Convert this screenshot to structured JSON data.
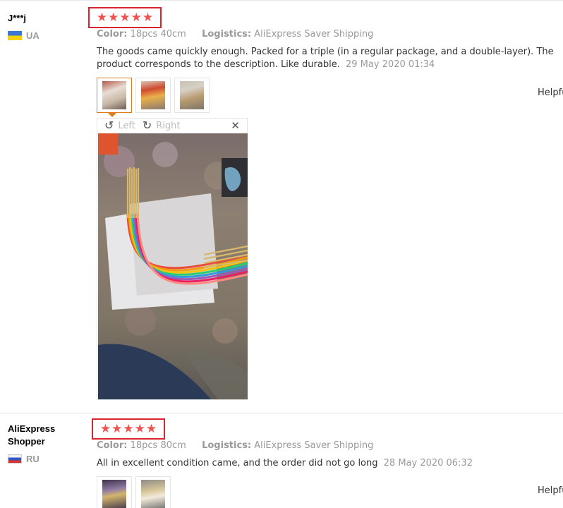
{
  "star_glyph": "★",
  "reviews": [
    {
      "user": "J***j",
      "country": "UA",
      "color_label": "Color:",
      "color_value": "18pcs 40cm",
      "logistics_label": "Logistics:",
      "logistics_value": "AliExpress Saver Shipping",
      "text": "The goods came quickly enough. Packed for a triple (in a regular package, and a double-layer). The product corresponds to the description. Like durable.",
      "date": "29 May 2020 01:34",
      "helpful": "Helpful?",
      "rating": 5
    },
    {
      "user": "AliExpress Shopper",
      "country": "RU",
      "color_label": "Color:",
      "color_value": "18pcs 80cm",
      "logistics_label": "Logistics:",
      "logistics_value": "AliExpress Saver Shipping",
      "text": "All in excellent condition came, and the order did not go long",
      "date": "28 May 2020 06:32",
      "helpful": "Helpful?",
      "rating": 5
    }
  ],
  "viewer": {
    "rotate_left": "Left",
    "rotate_right": "Right",
    "rotate_left_icon": "↺",
    "rotate_right_icon": "↻",
    "close_icon": "✕"
  },
  "colors": {
    "star": "#ef5350",
    "highlight_box": "#d9232d",
    "active_thumb": "#e07b1b"
  }
}
